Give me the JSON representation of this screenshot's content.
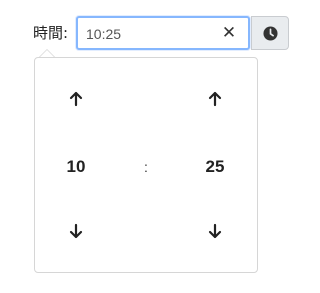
{
  "form": {
    "label": "時間:",
    "time_value": "10:25",
    "clear_symbol": "✕",
    "clock_icon": "clock-icon"
  },
  "picker": {
    "hours": "10",
    "minutes": "25",
    "separator": ":",
    "up_icon": "arrow-up-icon",
    "down_icon": "arrow-down-icon"
  }
}
